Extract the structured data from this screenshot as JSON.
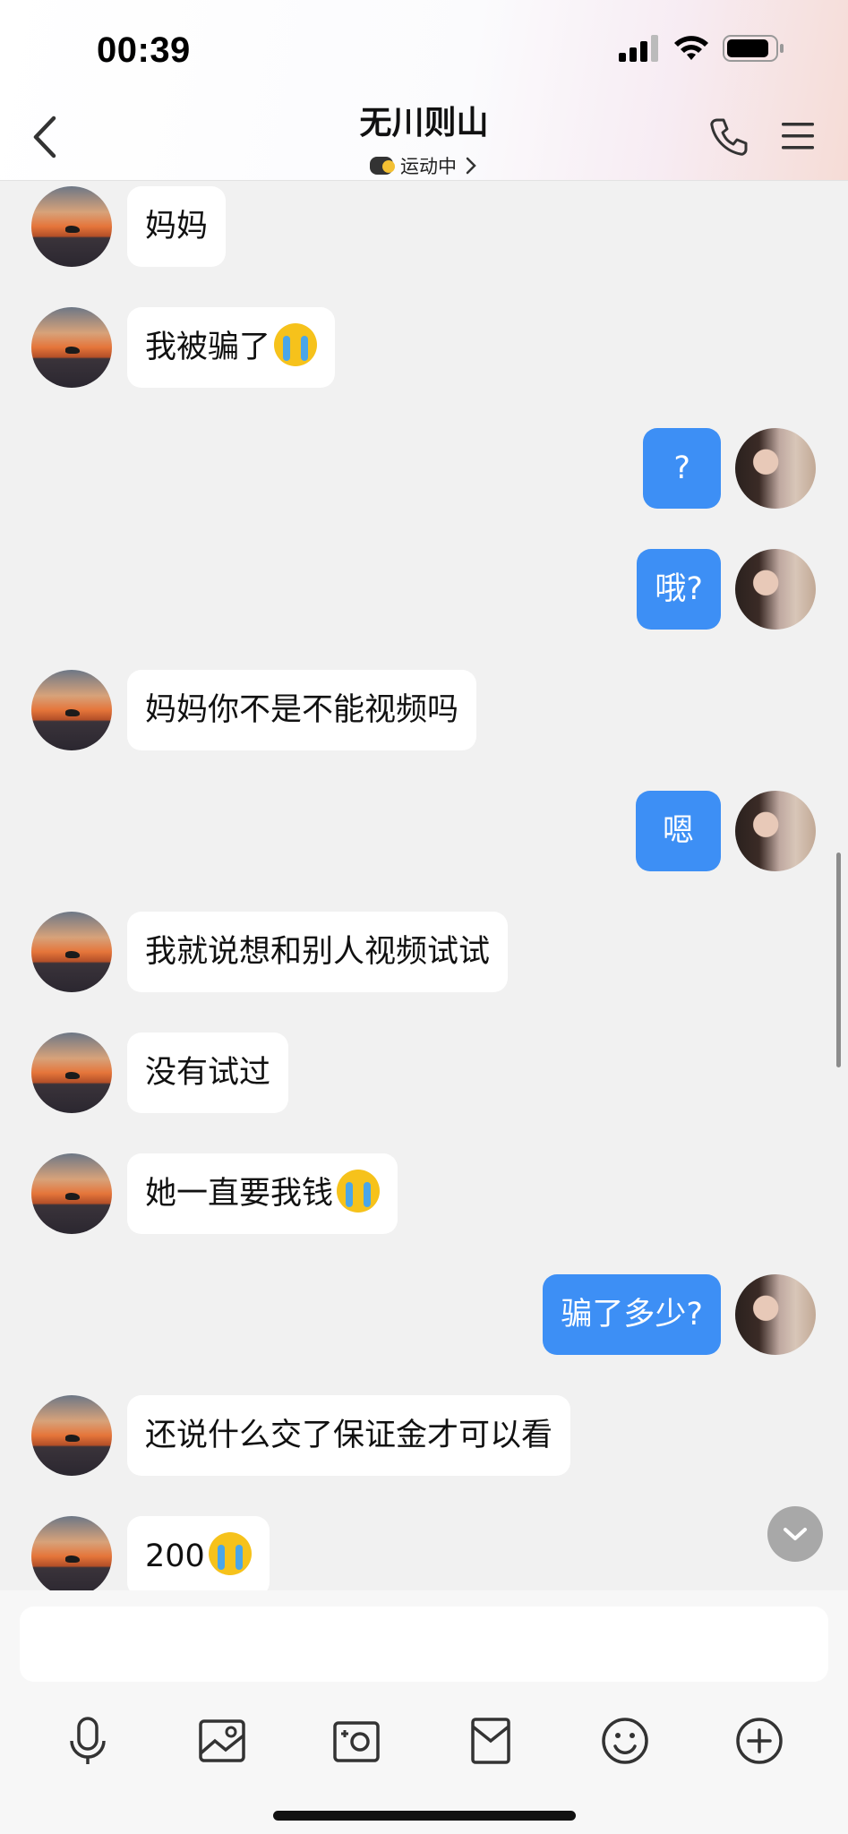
{
  "status_bar": {
    "time": "00:39"
  },
  "header": {
    "title": "无川则山",
    "subtitle": "运动中"
  },
  "messages": [
    {
      "side": "in",
      "text": "妈妈",
      "emoji": false
    },
    {
      "side": "in",
      "text": "我被骗了",
      "emoji": true
    },
    {
      "side": "out",
      "text": "?",
      "emoji": false
    },
    {
      "side": "out",
      "text": "哦?",
      "emoji": false
    },
    {
      "side": "in",
      "text": "妈妈你不是不能视频吗",
      "emoji": false
    },
    {
      "side": "out",
      "text": "嗯",
      "emoji": false
    },
    {
      "side": "in",
      "text": "我就说想和别人视频试试",
      "emoji": false
    },
    {
      "side": "in",
      "text": "没有试过",
      "emoji": false
    },
    {
      "side": "in",
      "text": "她一直要我钱",
      "emoji": true
    },
    {
      "side": "out",
      "text": "骗了多少?",
      "emoji": false
    },
    {
      "side": "in",
      "text": "还说什么交了保证金才可以看",
      "emoji": false
    },
    {
      "side": "in",
      "text": "200",
      "emoji": true
    }
  ],
  "icons": {
    "back": "chevron-left-icon",
    "phone": "phone-icon",
    "menu": "menu-icon",
    "crying_emoji": "crying-face-emoji",
    "scroll_down": "chevron-down-icon"
  },
  "toolbar": [
    "microphone-icon",
    "image-icon",
    "camera-icon",
    "red-packet-icon",
    "smiley-icon",
    "plus-circle-icon"
  ],
  "colors": {
    "outgoing_bubble": "#3d8ff5",
    "incoming_bubble": "#ffffff",
    "background": "#f1f1f1"
  }
}
